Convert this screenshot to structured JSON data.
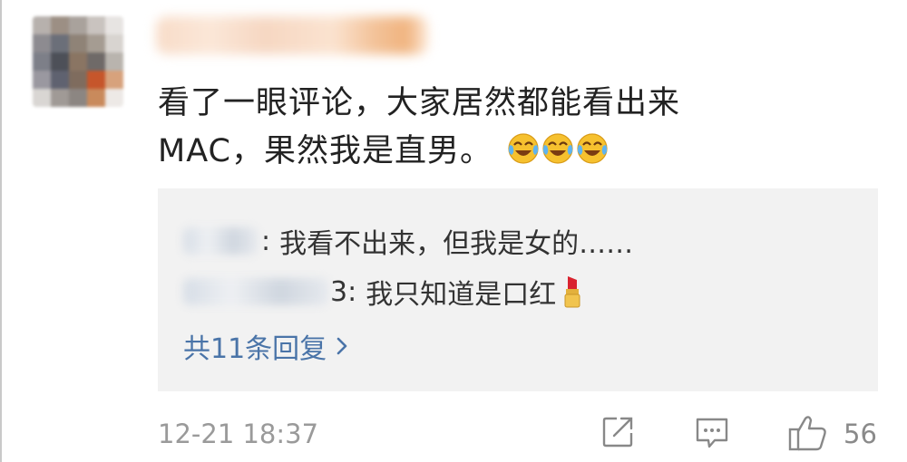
{
  "comment": {
    "text_line1": "看了一眼评论，大家居然都能看出来",
    "text_line2": "MAC，果然我是直男。",
    "emoji": "tears-of-joy-emoji"
  },
  "replies": [
    {
      "name_suffix": ":",
      "text": "我看不出来，但我是女的……"
    },
    {
      "name_suffix": "3:",
      "text": "我只知道是口红",
      "emoji": "lipstick-emoji"
    }
  ],
  "more_replies_label": "共11条回复",
  "timestamp": "12-21 18:37",
  "like_count": "56",
  "colors": {
    "link": "#4a74a8",
    "reply_bg": "#f2f2f2",
    "meta_text": "#9a9a9a"
  }
}
